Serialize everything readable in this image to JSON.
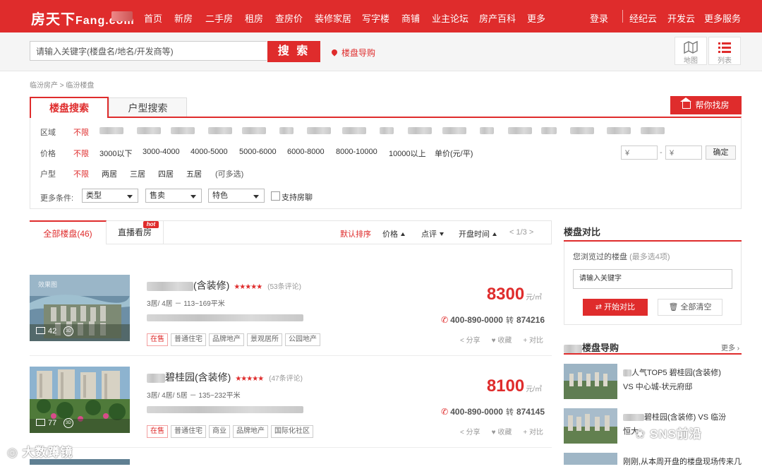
{
  "brand": {
    "logo_main": "房天下",
    "logo_sub": "Fang.com"
  },
  "nav": {
    "items": [
      "首页",
      "新房",
      "二手房",
      "租房",
      "查房价",
      "装修家居",
      "写字楼",
      "商铺",
      "业主论坛",
      "房产百科",
      "更多"
    ],
    "login": "登录",
    "right": [
      "经纪云",
      "开发云",
      "更多服务"
    ]
  },
  "search": {
    "placeholder": "请输入关键字(楼盘名/地名/开发商等)",
    "button": "搜 索",
    "guide": "楼盘导购"
  },
  "view": {
    "map": "地图",
    "list": "列表"
  },
  "breadcrumb": "临汾房产 > 临汾楼盘",
  "filter": {
    "tabs": [
      "楼盘搜索",
      "户型搜索"
    ],
    "help_button": "帮你找房",
    "region_label": "区域",
    "unlimited": "不限",
    "price_label": "价格",
    "price_options": [
      "3000以下",
      "3000-4000",
      "4000-5000",
      "5000-6000",
      "6000-8000",
      "8000-10000",
      "10000以上",
      "单价(元/平)"
    ],
    "price_min": "¥",
    "price_dash": "-",
    "price_max": "¥",
    "confirm": "确定",
    "layout_label": "户型",
    "layout_options": [
      "两居",
      "三居",
      "四居",
      "五居",
      "(可多选)"
    ],
    "more_label": "更多条件:",
    "selects": [
      "类型",
      "售卖",
      "特色"
    ],
    "checkbox_label": "支持房聊"
  },
  "list_tabs": {
    "all": "全部楼盘(46)",
    "live": "直播看房",
    "hot": "hot",
    "sorts": [
      "默认排序",
      "价格",
      "点评",
      "开盘时间"
    ],
    "page": "< 1/3 >"
  },
  "listings": [
    {
      "title_suffix": "(含装修)",
      "stars": "★★★★★",
      "reviews": "(53条评论)",
      "spec": "3居/ 4居 － 113~169平米",
      "price": "8300",
      "unit": "元/㎡",
      "phone": "400-890-0000",
      "ext_label": "转",
      "ext": "874216",
      "tags": [
        "在售",
        "普通住宅",
        "品牌地产",
        "景观居所",
        "公园地产"
      ],
      "img_count": "42",
      "img_label": "效果图",
      "vr": "3D",
      "actions": [
        "分享",
        "收藏",
        "对比"
      ]
    },
    {
      "title_suffix": "碧桂园(含装修)",
      "stars": "★★★★★",
      "reviews": "(47条评论)",
      "spec": "3居/ 4居/ 5居 － 135~232平米",
      "price": "8100",
      "unit": "元/㎡",
      "phone": "400-890-0000",
      "ext_label": "转",
      "ext": "874145",
      "tags": [
        "在售",
        "普通住宅",
        "商业",
        "品牌地产",
        "国际化社区"
      ],
      "img_count": "77",
      "vr": "3D",
      "actions": [
        "分享",
        "收藏",
        "对比"
      ]
    }
  ],
  "compare": {
    "title": "楼盘对比",
    "hint": "您浏览过的楼盘",
    "hint_note": "(最多选4项)",
    "input_value": "请输入关键字",
    "start": "开始对比",
    "clear": "全部清空"
  },
  "guide": {
    "title_suffix": "楼盘导购",
    "more": "更多",
    "items": [
      {
        "line1": "人气TOP5 碧桂园(含装修)",
        "line2": "VS 中心城-状元府邸"
      },
      {
        "line1": "碧桂园(含装修) VS 临汾",
        "line2": "恒大"
      },
      {
        "line1": "刚刚,从本周开盘的楼盘现场传来几",
        "line2": ""
      }
    ]
  },
  "watermarks": {
    "left": "大数蹲镜",
    "right": "SNS前沿"
  }
}
